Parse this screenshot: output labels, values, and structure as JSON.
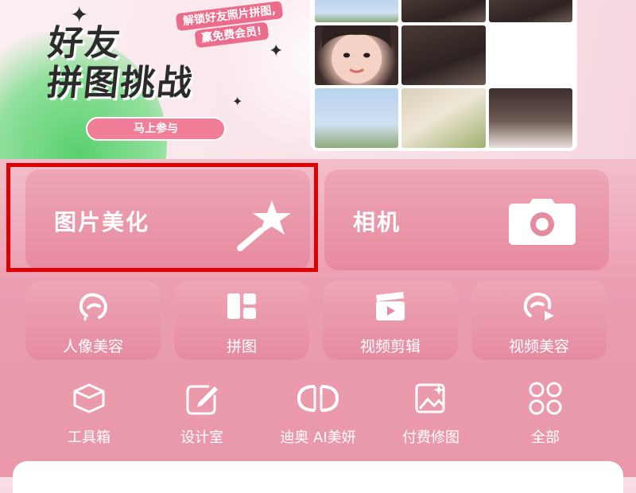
{
  "banner": {
    "title_line1": "好友",
    "title_line2": "拼图挑战",
    "subtitle_line1": "解锁好友照片拼图,",
    "subtitle_line2": "赢免费会员!",
    "join_label": "马上参与"
  },
  "features": {
    "photo_edit": "图片美化",
    "camera": "相机"
  },
  "tools": [
    {
      "label": "人像美容",
      "icon": "face-retouch-icon"
    },
    {
      "label": "拼图",
      "icon": "collage-icon"
    },
    {
      "label": "视频剪辑",
      "icon": "video-edit-icon"
    },
    {
      "label": "视频美容",
      "icon": "video-beauty-icon"
    }
  ],
  "more": [
    {
      "label": "工具箱",
      "icon": "toolbox-icon"
    },
    {
      "label": "设计室",
      "icon": "design-icon"
    },
    {
      "label": "迪奥 AI美妍",
      "icon": "dior-icon"
    },
    {
      "label": "付费修图",
      "icon": "paid-retouch-icon"
    },
    {
      "label": "全部",
      "icon": "all-icon"
    }
  ],
  "colors": {
    "highlight": "#e10000",
    "tile_pink": "#e78aa0",
    "accent": "#ec6c8b"
  }
}
